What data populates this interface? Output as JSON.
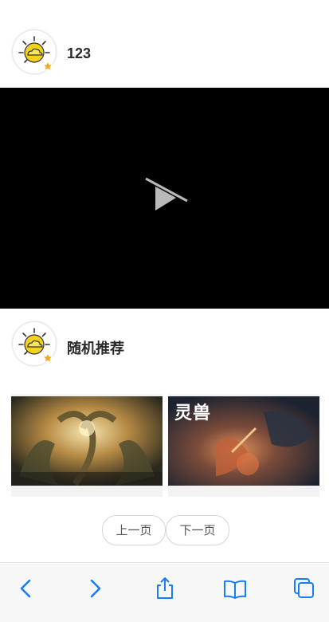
{
  "post": {
    "username": "123",
    "avatar_icon": "sun-cloud-avatar-icon"
  },
  "video": {
    "state_icon": "video-unavailable-icon"
  },
  "recommend": {
    "title": "随机推荐",
    "avatar_icon": "sun-cloud-avatar-icon",
    "cards": [
      {
        "image": "mythical-serpent-artwork",
        "caption": ""
      },
      {
        "image": "warrior-battle-artwork",
        "caption": "灵兽"
      }
    ]
  },
  "pager": {
    "prev_label": "上一页",
    "next_label": "下一页"
  },
  "browser_toolbar": {
    "items": [
      "back-icon",
      "forward-icon",
      "share-icon",
      "bookmarks-icon",
      "tabs-icon"
    ],
    "accent_color": "#1a7cf5"
  }
}
